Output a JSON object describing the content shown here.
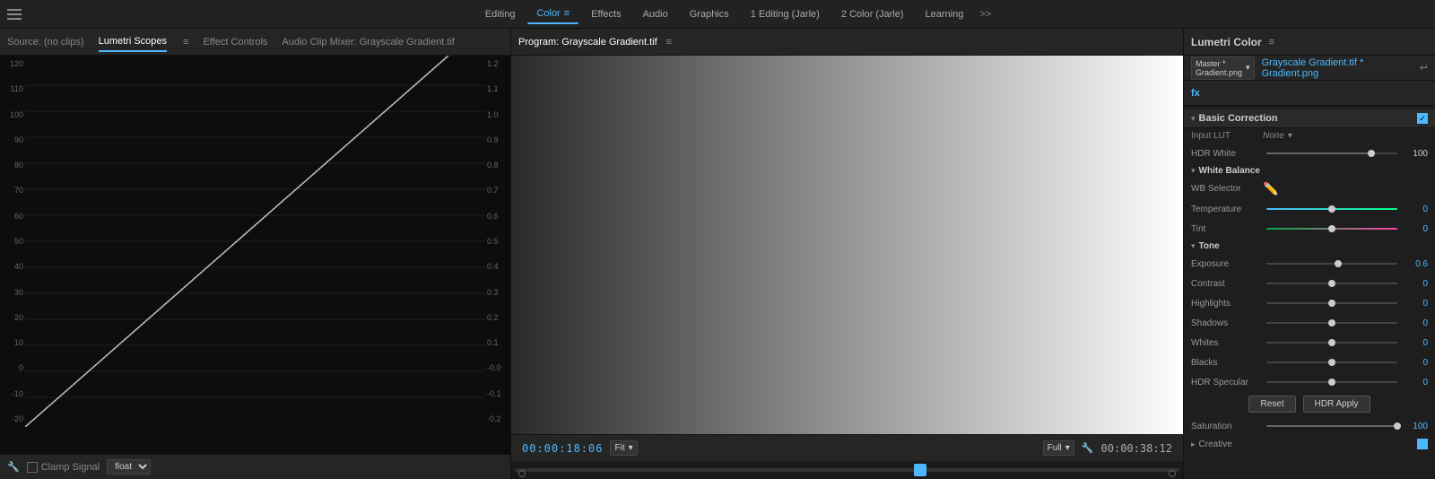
{
  "topbar": {
    "menu_items": [
      {
        "label": "Editing",
        "active": false
      },
      {
        "label": "Color",
        "active": true
      },
      {
        "label": "Effects",
        "active": false
      },
      {
        "label": "Audio",
        "active": false
      },
      {
        "label": "Graphics",
        "active": false
      },
      {
        "label": "1 Editing (Jarle)",
        "active": false
      },
      {
        "label": "2 Color (Jarle)",
        "active": false
      },
      {
        "label": "Learning",
        "active": false
      }
    ],
    "more_label": ">>"
  },
  "left_panel": {
    "tabs": [
      {
        "label": "Source: (no clips)",
        "active": false
      },
      {
        "label": "Lumetri Scopes",
        "active": true
      },
      {
        "label": "Effect Controls",
        "active": false
      },
      {
        "label": "Audio Clip Mixer: Grayscale Gradient.tif",
        "active": false
      }
    ],
    "y_labels": [
      "120",
      "110",
      "100",
      "90",
      "80",
      "70",
      "60",
      "50",
      "40",
      "30",
      "20",
      "10",
      "0",
      "-10",
      "-20"
    ],
    "x_labels": [
      "1.2",
      "1.1",
      "1.0",
      "0.9",
      "0.8",
      "0.7",
      "0.6",
      "0.5",
      "0.4",
      "0.3",
      "0.2",
      "0.1",
      "-0.0",
      "-0.1",
      "-0.2"
    ],
    "toolbar": {
      "clamp_label": "Clamp Signal",
      "float_label": "float"
    }
  },
  "center_panel": {
    "title": "Program: Grayscale Gradient.tif",
    "timecode_start": "00:00:18:06",
    "fit_label": "Fit",
    "quality_label": "Full",
    "timecode_end": "00:00:38:12"
  },
  "right_panel": {
    "title": "Lumetri Color",
    "clip_selector": "Master * Gradient.png",
    "clip_active": "Grayscale Gradient.tif * Gradient.png",
    "fx_label": "fx",
    "sections": {
      "basic_correction": {
        "label": "Basic Correction",
        "enabled": true,
        "input_lut": "None",
        "hdr_white": 100,
        "white_balance": {
          "temperature": 0.0,
          "tint": 0.0
        },
        "tone": {
          "exposure": 0.6,
          "contrast": 0.0,
          "highlights": 0.0,
          "shadows": 0.0,
          "whites": 0.0,
          "blacks": 0.0,
          "hdr_specular": 0.0
        },
        "saturation": 100.0
      },
      "creative": {
        "label": "Creative",
        "enabled": true
      }
    }
  }
}
